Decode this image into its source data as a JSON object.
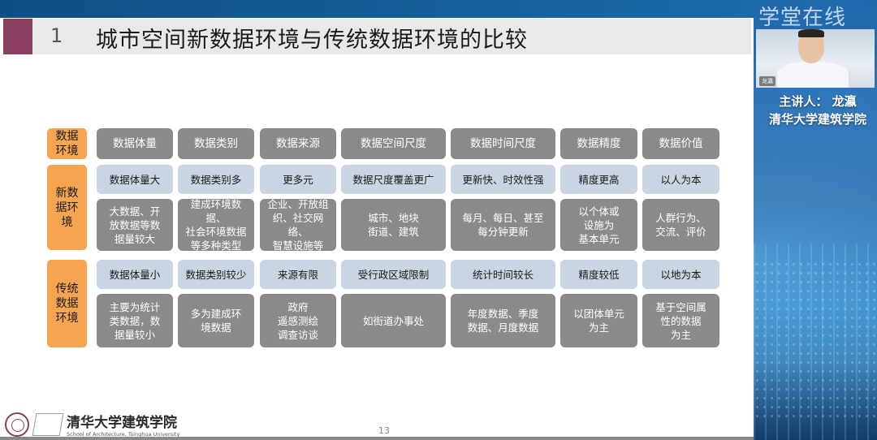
{
  "slide": {
    "number": "1",
    "title": "城市空间新数据环境与传统数据环境的比较",
    "page": "13"
  },
  "brand": {
    "logo_text": "学堂在线",
    "lecturer_line1": "主讲人：  龙瀛",
    "lecturer_line2": "清华大学建筑学院",
    "webcam_tag": "龙瀛",
    "school_cn": "清华大学建筑学院",
    "school_en": "School of Architecture, Tsinghua University"
  },
  "table": {
    "corner": "数据\n环境",
    "headers": [
      "数据体量",
      "数据类别",
      "数据来源",
      "数据空间尺度",
      "数据时间尺度",
      "数据精度",
      "数据价值"
    ],
    "new": {
      "label": "新数\n据环\n境",
      "summary": [
        "数据体量大",
        "数据类别多",
        "更多元",
        "数据尺度覆盖更广",
        "更新快、时效性强",
        "精度更高",
        "以人为本"
      ],
      "detail": [
        "大数据、开\n放数据等数\n据量较大",
        "建成环境数据、\n社会环境数据\n等多种类型",
        "企业、开放组\n织、社交网络、\n智慧设施等",
        "城市、地块\n街道、建筑",
        "每月、每日、甚至\n每分钟更新",
        "以个体或\n设施为\n基本单元",
        "人群行为、\n交流、评价"
      ]
    },
    "traditional": {
      "label": "传统\n数据\n环境",
      "summary": [
        "数据体量小",
        "数据类别较少",
        "来源有限",
        "受行政区域限制",
        "统计时间较长",
        "精度较低",
        "以地为本"
      ],
      "detail": [
        "主要为统计\n类数据，数\n据量较小",
        "多为建成环\n境数据",
        "政府\n遥感测绘\n调查访谈",
        "如街道办事处",
        "年度数据、季度\n数据、月度数据",
        "以团体单元\n为主",
        "基于空间属\n性的数据\n为主"
      ]
    }
  },
  "colors": {
    "row_label": "#f5a452",
    "header_cell": "#8a8a8a",
    "summary_cell": "#c9d5e2",
    "detail_cell": "#8a8a8a",
    "title_accent": "#8a3e60"
  },
  "icons": [
    "xuetangx-logo-icon",
    "tsinghua-seal-icon",
    "architecture-cube-icon"
  ]
}
